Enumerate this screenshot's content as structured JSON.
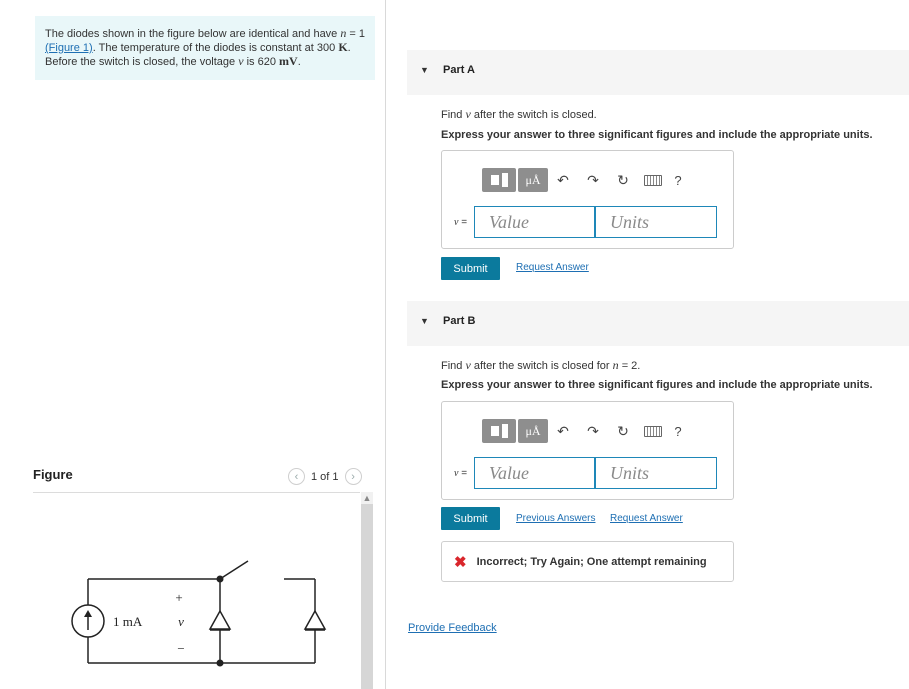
{
  "problem": {
    "text_1": "The diodes shown in the figure below are identical and have ",
    "n_symbol": "n",
    "text_2": " = 1",
    "figure_link": "(Figure 1)",
    "text_3": ". The temperature of the diodes is constant at 300 ",
    "temp_unit": "K",
    "text_4": ".",
    "text_5": "Before the switch is closed, the voltage ",
    "v_symbol": "v",
    "text_6": " is 620 ",
    "volt_unit": "mV",
    "text_7": "."
  },
  "figure": {
    "label": "Figure",
    "pager": "1 of 1",
    "prev_icon": "‹",
    "next_icon": "›",
    "source_label": "1 mA",
    "plus": "+",
    "v_label": "v",
    "minus": "−"
  },
  "toolbar": {
    "units_label": "μÅ",
    "undo": "↶",
    "redo": "↷",
    "reset": "↻",
    "help": "?"
  },
  "part_a": {
    "title": "Part A",
    "q_1": "Find ",
    "q_v": "v",
    "q_2": " after the switch is closed.",
    "instruction": "Express your answer to three significant figures and include the appropriate units.",
    "v_label": "v",
    "eq": " =",
    "value_placeholder": "Value",
    "units_placeholder": "Units",
    "submit": "Submit",
    "request_answer": "Request Answer"
  },
  "part_b": {
    "title": "Part B",
    "q_1": "Find ",
    "q_v": "v",
    "q_2": " after the switch is closed for ",
    "q_n": "n",
    "q_3": " = 2.",
    "instruction": "Express your answer to three significant figures and include the appropriate units.",
    "v_label": "v",
    "eq": " =",
    "value_placeholder": "Value",
    "units_placeholder": "Units",
    "submit": "Submit",
    "previous_answers": "Previous Answers",
    "request_answer": "Request Answer",
    "feedback_icon": "✖",
    "feedback_text": "Incorrect; Try Again; One attempt remaining"
  },
  "footer": {
    "provide_feedback": "Provide Feedback"
  }
}
